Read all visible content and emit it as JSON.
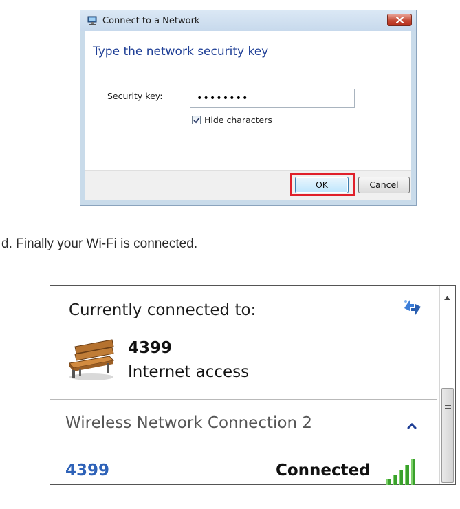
{
  "dialog": {
    "title": "Connect to a Network",
    "heading": "Type the network security key",
    "security_key_label": "Security key:",
    "security_key_value": "••••••••",
    "hide_characters_label": "Hide characters",
    "hide_characters_checked": true,
    "ok_label": "OK",
    "cancel_label": "Cancel",
    "highlight_color": "#e0202a"
  },
  "instruction": {
    "text": "d. Finally your Wi-Fi is connected."
  },
  "network_panel": {
    "currently_connected_title": "Currently connected to:",
    "connected_network": {
      "name": "4399",
      "status": "Internet access"
    },
    "section_title": "Wireless Network Connection 2",
    "wifi_item": {
      "name": "4399",
      "status": "Connected",
      "name_color": "#2e62b8"
    }
  },
  "icons": {
    "dialog_title": "network-icon",
    "close": "close-icon",
    "refresh": "refresh-icon",
    "network_type": "bench-icon",
    "collapse": "chevron-up-icon",
    "signal": "signal-strength-icon"
  }
}
